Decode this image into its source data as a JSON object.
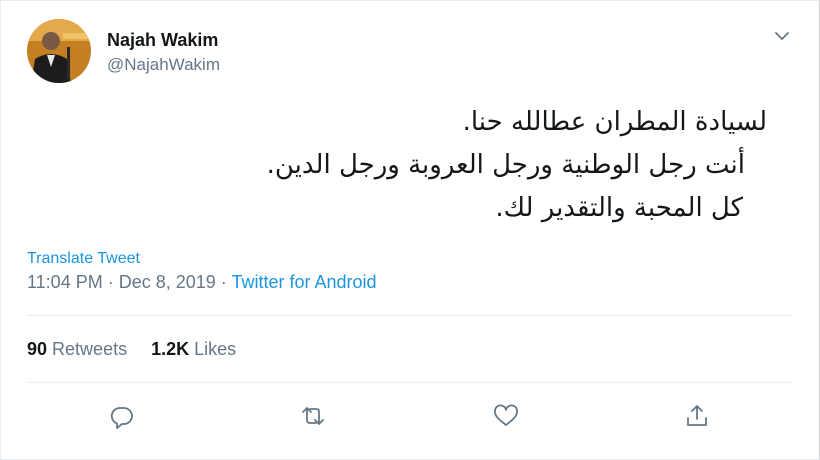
{
  "user": {
    "name": "Najah Wakim",
    "handle": "@NajahWakim"
  },
  "tweet": {
    "lines": [
      "لسيادة المطران عطالله حنا.",
      "أنت رجل الوطنية ورجل العروبة ورجل الدين.",
      "كل المحبة والتقدير لك."
    ]
  },
  "translate_label": "Translate Tweet",
  "meta": {
    "time": "11:04 PM",
    "separator": " · ",
    "date": "Dec 8, 2019",
    "source": "Twitter for Android"
  },
  "stats": {
    "retweets_count": "90",
    "retweets_label": "Retweets",
    "likes_count": "1.2K",
    "likes_label": "Likes"
  },
  "icons": {
    "menu": "chevron-down-icon",
    "reply": "reply-icon",
    "retweet": "retweet-icon",
    "like": "heart-icon",
    "share": "share-icon"
  },
  "colors": {
    "link": "#1b95e0",
    "secondary_text": "#657786",
    "primary_text": "#14171a",
    "icon": "#657786",
    "divider": "#e6ecf0"
  }
}
